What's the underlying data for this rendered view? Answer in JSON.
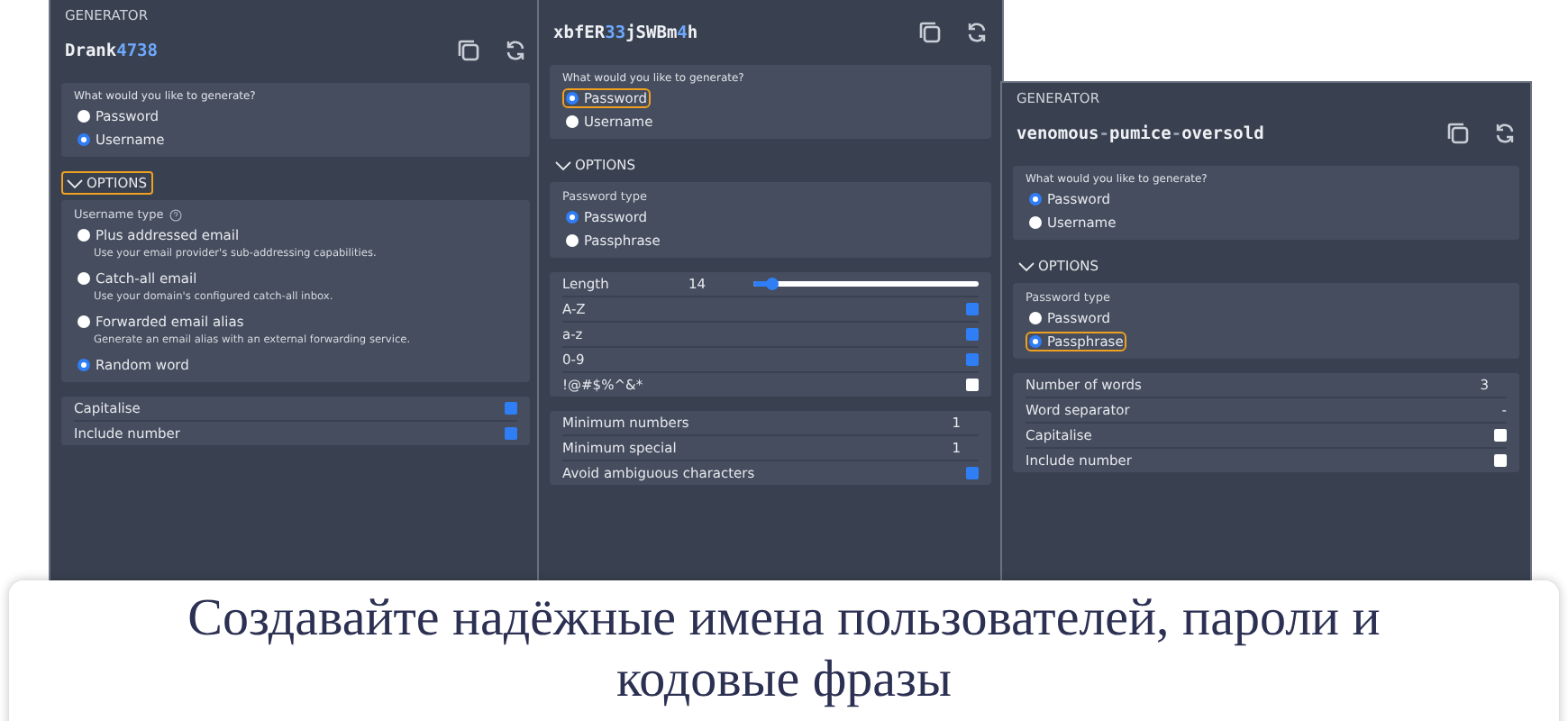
{
  "panels": [
    {
      "header": "GENERATOR",
      "generated": [
        {
          "text": "Drank",
          "kind": "letter"
        },
        {
          "text": "4738",
          "kind": "number"
        }
      ],
      "question": "What would you like to generate?",
      "type_options": [
        {
          "label": "Password",
          "selected": false,
          "focused": false
        },
        {
          "label": "Username",
          "selected": true,
          "focused": false
        }
      ],
      "options_toggle": {
        "label": "OPTIONS",
        "expanded": true,
        "focused": true
      },
      "subtype": {
        "label": "Username type",
        "help": true,
        "options": [
          {
            "label": "Plus addressed email",
            "description": "Use your email provider's sub-addressing capabilities.",
            "selected": false,
            "focused": false
          },
          {
            "label": "Catch-all email",
            "description": "Use your domain's configured catch-all inbox.",
            "selected": false,
            "focused": false
          },
          {
            "label": "Forwarded email alias",
            "description": "Generate an email alias with an external forwarding service.",
            "selected": false,
            "focused": false
          },
          {
            "label": "Random word",
            "selected": true,
            "focused": false
          }
        ]
      },
      "setting_groups": [
        [
          {
            "kind": "checkbox",
            "label": "Capitalise",
            "checked": true
          },
          {
            "kind": "checkbox",
            "label": "Include number",
            "checked": true
          }
        ]
      ]
    },
    {
      "generated": [
        {
          "text": "xbfER",
          "kind": "letter"
        },
        {
          "text": "33",
          "kind": "number"
        },
        {
          "text": "jSWBm",
          "kind": "letter"
        },
        {
          "text": "4",
          "kind": "number"
        },
        {
          "text": "h",
          "kind": "letter"
        }
      ],
      "question": "What would you like to generate?",
      "type_options": [
        {
          "label": "Password",
          "selected": true,
          "focused": true
        },
        {
          "label": "Username",
          "selected": false,
          "focused": false
        }
      ],
      "options_toggle": {
        "label": "OPTIONS",
        "expanded": true,
        "focused": false
      },
      "subtype": {
        "label": "Password type",
        "options": [
          {
            "label": "Password",
            "selected": true,
            "focused": false
          },
          {
            "label": "Passphrase",
            "selected": false,
            "focused": false
          }
        ]
      },
      "setting_groups": [
        [
          {
            "kind": "slider",
            "label": "Length",
            "value": "14",
            "level": 0.08
          },
          {
            "kind": "checkbox",
            "label": "A-Z",
            "checked": true
          },
          {
            "kind": "checkbox",
            "label": "a-z",
            "checked": true
          },
          {
            "kind": "checkbox",
            "label": "0-9",
            "checked": true
          },
          {
            "kind": "checkbox",
            "label": "!@#$%^&*",
            "checked": false
          }
        ],
        [
          {
            "kind": "number",
            "label": "Minimum numbers",
            "value": "1"
          },
          {
            "kind": "number",
            "label": "Minimum special",
            "value": "1"
          },
          {
            "kind": "checkbox",
            "label": "Avoid ambiguous characters",
            "checked": true
          }
        ]
      ]
    },
    {
      "header": "GENERATOR",
      "generated": [
        {
          "text": "venomous",
          "kind": "letter"
        },
        {
          "text": "-",
          "kind": "special"
        },
        {
          "text": "pumice",
          "kind": "letter"
        },
        {
          "text": "-",
          "kind": "special"
        },
        {
          "text": "oversold",
          "kind": "letter"
        }
      ],
      "question": "What would you like to generate?",
      "type_options": [
        {
          "label": "Password",
          "selected": true,
          "focused": false
        },
        {
          "label": "Username",
          "selected": false,
          "focused": false
        }
      ],
      "options_toggle": {
        "label": "OPTIONS",
        "expanded": true,
        "focused": false
      },
      "subtype": {
        "label": "Password type",
        "options": [
          {
            "label": "Password",
            "selected": false,
            "focused": false
          },
          {
            "label": "Passphrase",
            "selected": true,
            "focused": true
          }
        ]
      },
      "setting_groups": [
        [
          {
            "kind": "number",
            "label": "Number of words",
            "value": "3"
          },
          {
            "kind": "text",
            "label": "Word separator",
            "value": "-"
          },
          {
            "kind": "checkbox",
            "label": "Capitalise",
            "checked": false
          },
          {
            "kind": "checkbox",
            "label": "Include number",
            "checked": false
          }
        ]
      ]
    }
  ],
  "caption": "Создавайте надёжные имена пользователей, пароли и кодовые фразы"
}
